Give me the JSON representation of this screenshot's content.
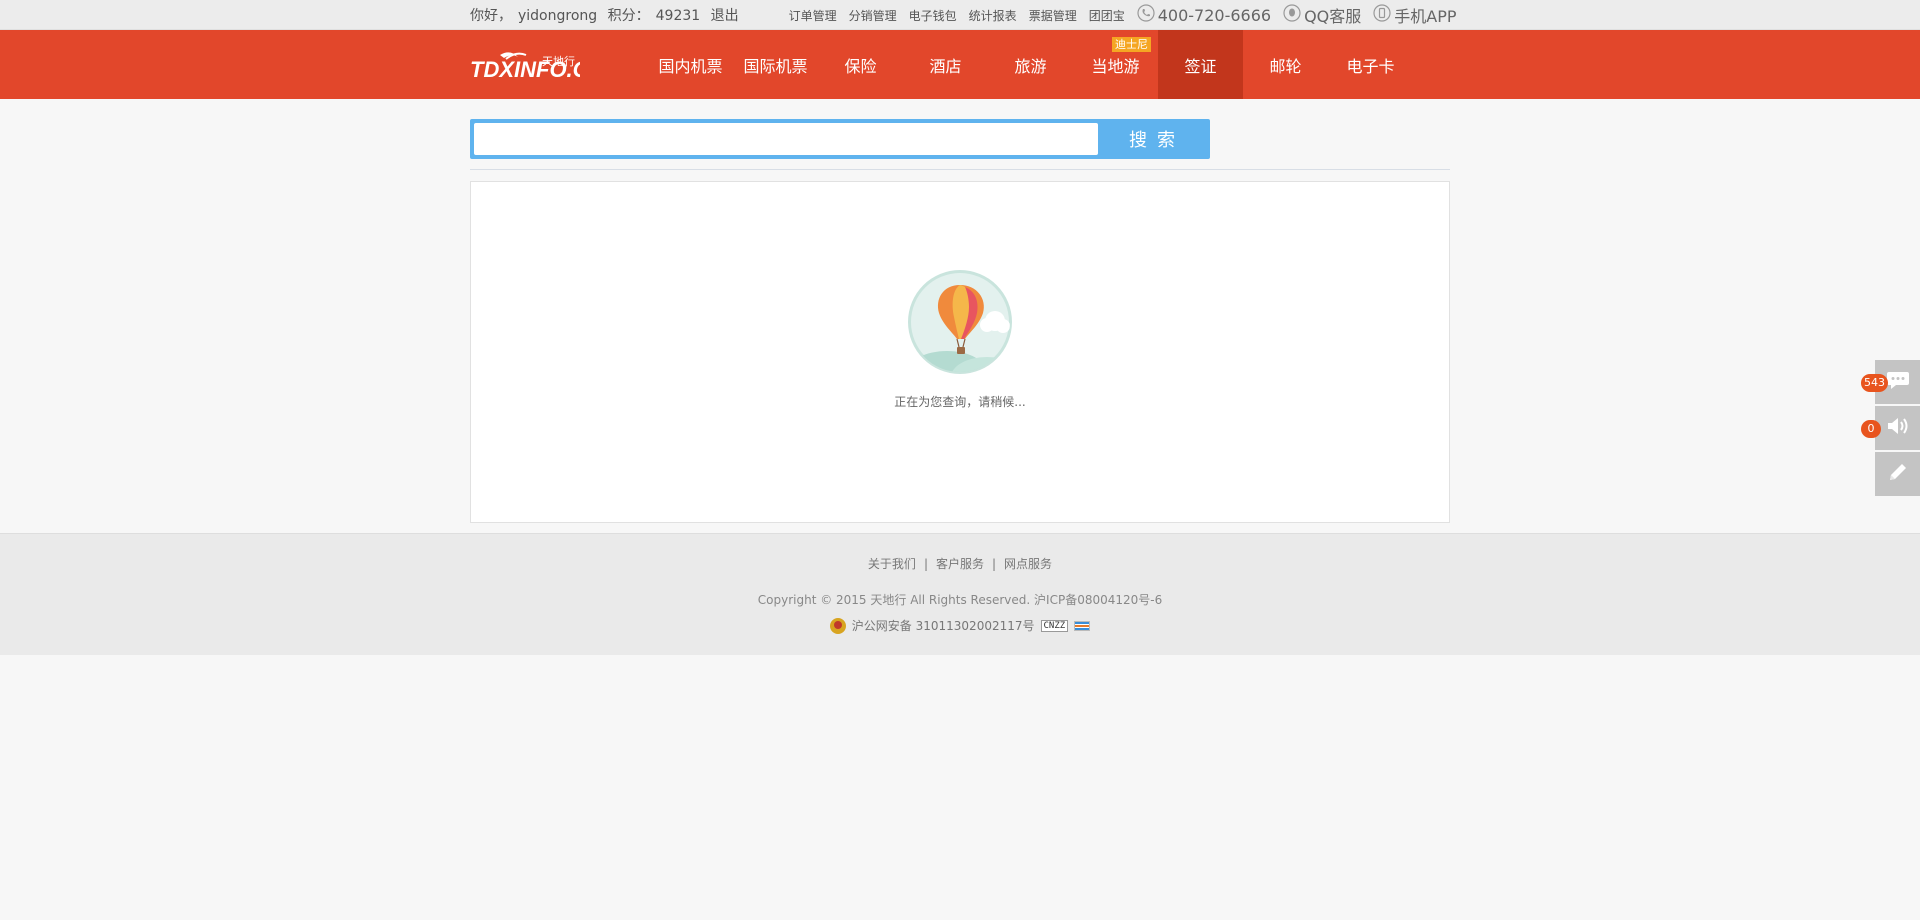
{
  "topbar": {
    "greeting": "你好，",
    "username": "yidongrong",
    "points_label": "积分：",
    "points": "49231",
    "logout": "退出",
    "links": [
      "订单管理",
      "分销管理",
      "电子钱包",
      "统计报表",
      "票据管理",
      "团团宝"
    ],
    "phone": "400-720-6666",
    "qq": "QQ客服",
    "app": "手机APP"
  },
  "nav": {
    "logo_text": "TDXINFO.COM",
    "logo_cn": "天地行",
    "items": [
      "国内机票",
      "国际机票",
      "保险",
      "酒店",
      "旅游",
      "当地游",
      "签证",
      "邮轮",
      "电子卡"
    ],
    "active_index": 6,
    "badge": "迪士尼"
  },
  "search": {
    "placeholder": "",
    "button": "搜索"
  },
  "panel": {
    "loading_text": "正在为您查询，请稍候..."
  },
  "footer": {
    "links": [
      "关于我们",
      "客户服务",
      "网点服务"
    ],
    "copyright": "Copyright © 2015 天地行 All Rights Reserved. 沪ICP备08004120号-6",
    "police": "沪公网安备 31011302002117号",
    "cnzz": "CNZZ"
  },
  "side": {
    "messages_count": "543",
    "notices_count": "0"
  },
  "colors": {
    "brand_red": "#e2472b",
    "active_red": "#c2361c",
    "search_blue": "#5fb3ee",
    "badge_orange": "#e8541e"
  }
}
